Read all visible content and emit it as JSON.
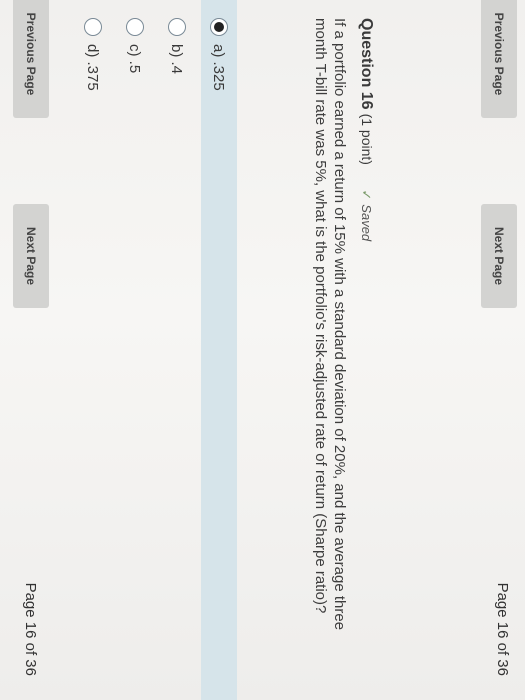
{
  "nav_top": {
    "previous_label": "Previous Page",
    "next_label": "Next Page",
    "page_indicator": "Page 16 of 36"
  },
  "question": {
    "title": "Question 16",
    "points": "(1 point)",
    "saved_label": "Saved",
    "text": "If a portfolio earned a return of 15% with a standard deviation of 20%, and the average three month T-bill rate was 5%, what is the portfolio's risk-adjusted rate of return (Sharpe ratio)?"
  },
  "options": [
    {
      "label": "a) .325",
      "selected": true
    },
    {
      "label": "b) .4",
      "selected": false
    },
    {
      "label": "c) .5",
      "selected": false
    },
    {
      "label": "d) .375",
      "selected": false
    }
  ],
  "nav_bottom": {
    "previous_label": "Previous Page",
    "next_label": "Next Page",
    "page_indicator": "Page 16 of 36"
  },
  "colors": {
    "selected_bg": "#d6e4ea",
    "button_bg": "#d3d3d1",
    "saved_check": "#7a9a6a"
  }
}
